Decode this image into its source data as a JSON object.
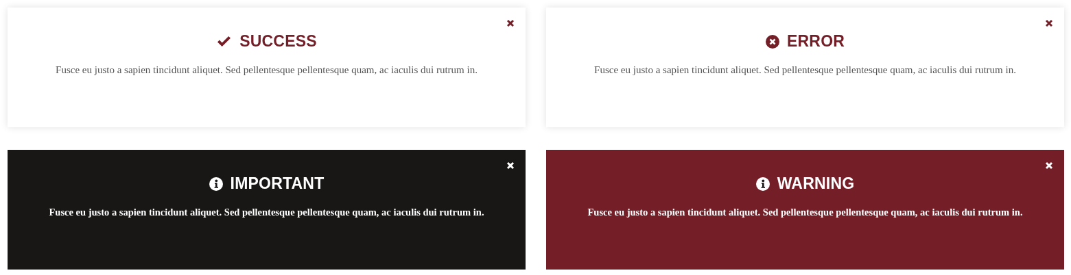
{
  "alerts": [
    {
      "kind": "success",
      "title": "SUCCESS",
      "message": "Fusce eu justo a sapien tincidunt aliquet. Sed pellentesque pellentesque quam, ac iaculis dui rutrum in.",
      "color": "#ffffff"
    },
    {
      "kind": "error",
      "title": "ERROR",
      "message": "Fusce eu justo a sapien tincidunt aliquet. Sed pellentesque pellentesque quam, ac iaculis dui rutrum in.",
      "color": "#ffffff"
    },
    {
      "kind": "info",
      "title": "IMPORTANT",
      "message": "Fusce eu justo a sapien tincidunt aliquet. Sed pellentesque pellentesque quam, ac iaculis dui rutrum in.",
      "color": "#181716"
    },
    {
      "kind": "info",
      "title": "WARNING",
      "message": "Fusce eu justo a sapien tincidunt aliquet. Sed pellentesque pellentesque quam, ac iaculis dui rutrum in.",
      "color": "#741f28"
    }
  ]
}
